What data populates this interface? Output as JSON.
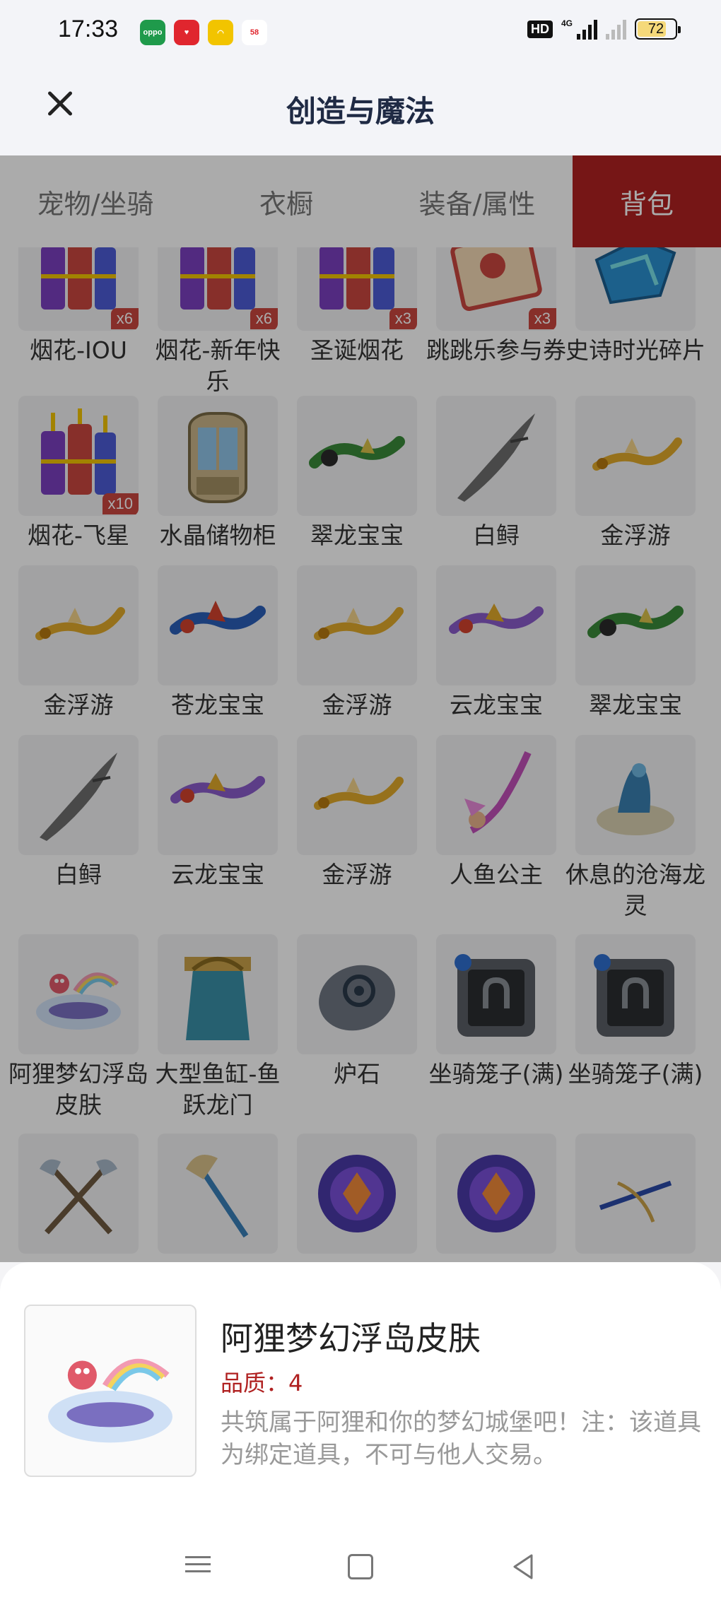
{
  "status_bar": {
    "time": "17:33",
    "app_icons": [
      {
        "name": "oppo-app-icon",
        "label": "oppo",
        "color": "#1f9a4b"
      },
      {
        "name": "heart-app-icon",
        "label": "♥",
        "color": "#e0262e"
      },
      {
        "name": "smile-app-icon",
        "label": "◠",
        "color": "#f2c400"
      },
      {
        "name": "58-app-icon",
        "label": "58",
        "color": "#ffffff"
      }
    ],
    "hd_label": "HD",
    "network_label": "4G",
    "battery": "72",
    "battery_level": 0.72
  },
  "header": {
    "title": "创造与魔法"
  },
  "tabs": [
    {
      "label": "宠物/坐骑",
      "active": false
    },
    {
      "label": "衣橱",
      "active": false
    },
    {
      "label": "装备/属性",
      "active": false
    },
    {
      "label": "背包",
      "active": true
    }
  ],
  "grid": [
    {
      "name": "烟花-IOU",
      "qty": "x6",
      "icon": "firework-icon"
    },
    {
      "name": "烟花-新年快乐",
      "qty": "x6",
      "icon": "firework-icon"
    },
    {
      "name": "圣诞烟花",
      "qty": "x3",
      "icon": "firework-icon"
    },
    {
      "name": "跳跳乐参与券",
      "qty": "x3",
      "icon": "ticket-icon"
    },
    {
      "name": "史诗时光碎片",
      "qty": "",
      "icon": "fragment-icon"
    },
    {
      "name": "烟花-飞星",
      "qty": "x10",
      "icon": "firework-icon"
    },
    {
      "name": "水晶储物柜",
      "qty": "",
      "icon": "cabinet-icon"
    },
    {
      "name": "翠龙宝宝",
      "qty": "",
      "icon": "dragon-green-icon"
    },
    {
      "name": "白鲟",
      "qty": "",
      "icon": "sturgeon-icon"
    },
    {
      "name": "金浮游",
      "qty": "",
      "icon": "dragon-gold-icon"
    },
    {
      "name": "金浮游",
      "qty": "",
      "icon": "dragon-gold-icon"
    },
    {
      "name": "苍龙宝宝",
      "qty": "",
      "icon": "dragon-blue-icon"
    },
    {
      "name": "金浮游",
      "qty": "",
      "icon": "dragon-gold-icon"
    },
    {
      "name": "云龙宝宝",
      "qty": "",
      "icon": "dragon-cloud-icon"
    },
    {
      "name": "翠龙宝宝",
      "qty": "",
      "icon": "dragon-green-icon"
    },
    {
      "name": "白鲟",
      "qty": "",
      "icon": "sturgeon-icon"
    },
    {
      "name": "云龙宝宝",
      "qty": "",
      "icon": "dragon-cloud-icon"
    },
    {
      "name": "金浮游",
      "qty": "",
      "icon": "dragon-gold-icon"
    },
    {
      "name": "人鱼公主",
      "qty": "",
      "icon": "mermaid-icon"
    },
    {
      "name": "休息的沧海龙灵",
      "qty": "",
      "icon": "sea-dragon-icon"
    },
    {
      "name": "阿狸梦幻浮岛皮肤",
      "qty": "",
      "icon": "floating-island-icon"
    },
    {
      "name": "大型鱼缸-鱼跃龙门",
      "qty": "",
      "icon": "aquarium-gate-icon"
    },
    {
      "name": "炉石",
      "qty": "",
      "icon": "hearthstone-icon"
    },
    {
      "name": "坐骑笼子(满)",
      "qty": "",
      "icon": "mount-cage-icon"
    },
    {
      "name": "坐骑笼子(满)",
      "qty": "",
      "icon": "mount-cage-icon"
    },
    {
      "name": "",
      "qty": "",
      "icon": "double-axe-icon"
    },
    {
      "name": "",
      "qty": "",
      "icon": "axe-icon"
    },
    {
      "name": "",
      "qty": "",
      "icon": "purple-gem-icon"
    },
    {
      "name": "",
      "qty": "",
      "icon": "purple-gem-icon"
    },
    {
      "name": "",
      "qty": "",
      "icon": "crossbow-icon"
    }
  ],
  "detail": {
    "title": "阿狸梦幻浮岛皮肤",
    "quality": "品质：4",
    "description": "共筑属于阿狸和你的梦幻城堡吧！注：该道具为绑定道具，不可与他人交易。",
    "icon": "floating-island-icon"
  }
}
